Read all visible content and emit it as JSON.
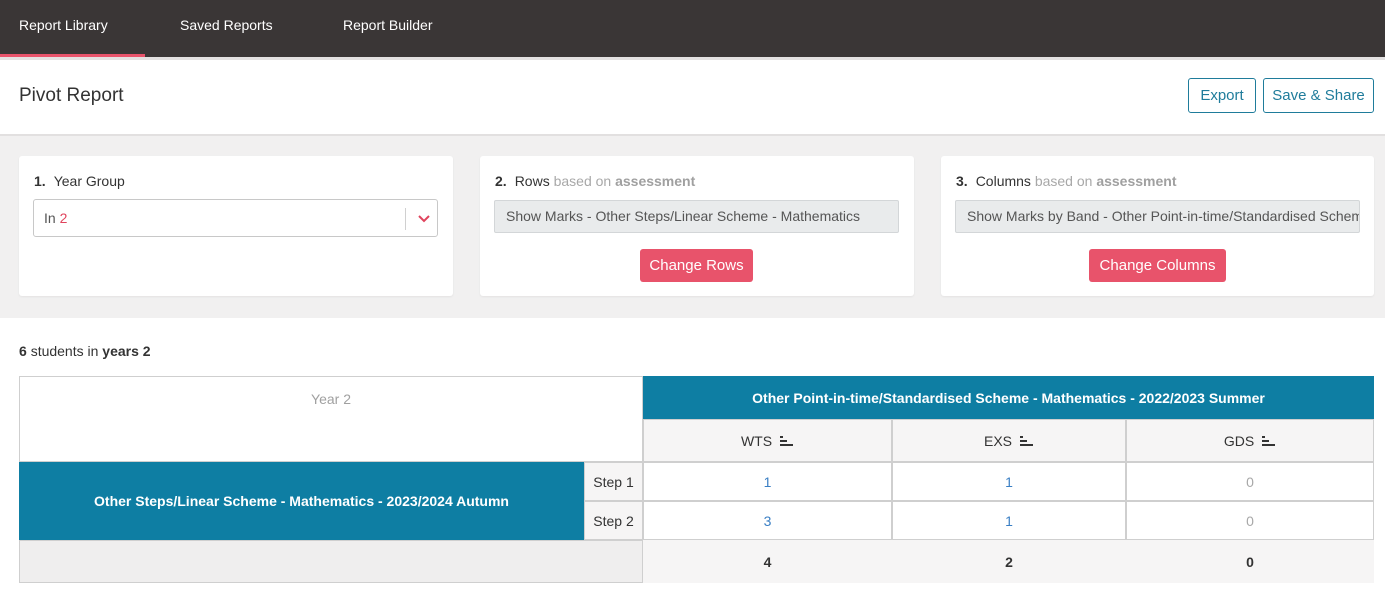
{
  "nav": {
    "tabs": [
      {
        "label": "Report Library",
        "active": true
      },
      {
        "label": "Saved Reports",
        "active": false
      },
      {
        "label": "Report Builder",
        "active": false
      }
    ]
  },
  "header": {
    "title": "Pivot Report",
    "export_label": "Export",
    "share_label": "Save & Share"
  },
  "filters": {
    "year_group": {
      "number": "1.",
      "label": "Year Group",
      "value_prefix": "In",
      "value": "2"
    },
    "rows": {
      "number": "2.",
      "label": "Rows",
      "based_on": "based on",
      "source": "assessment",
      "field_value": "Show Marks - Other Steps/Linear Scheme - Mathematics",
      "button_label": "Change Rows"
    },
    "columns": {
      "number": "3.",
      "label": "Columns",
      "based_on": "based on",
      "source": "assessment",
      "field_value": "Show Marks by Band - Other Point-in-time/Standardised Scheme - Mathematics",
      "button_label": "Change Columns"
    }
  },
  "summary": {
    "count": "6",
    "text_mid": "students in",
    "group": "years 2"
  },
  "pivot": {
    "corner_label": "Year 2",
    "column_group": "Other Point-in-time/Standardised Scheme - Mathematics - 2022/2023 Summer",
    "row_group": "Other Steps/Linear Scheme - Mathematics - 2023/2024 Autumn",
    "columns": [
      "WTS",
      "EXS",
      "GDS"
    ],
    "rows": [
      {
        "label": "Step 1",
        "values": [
          "1",
          "1",
          "0"
        ]
      },
      {
        "label": "Step 2",
        "values": [
          "3",
          "1",
          "0"
        ]
      }
    ],
    "totals": [
      "4",
      "2",
      "0"
    ]
  },
  "colors": {
    "nav_bg": "#3a3636",
    "accent_red": "#e8536b",
    "teal": "#0e7ea3",
    "link_blue": "#3a7fc4"
  }
}
